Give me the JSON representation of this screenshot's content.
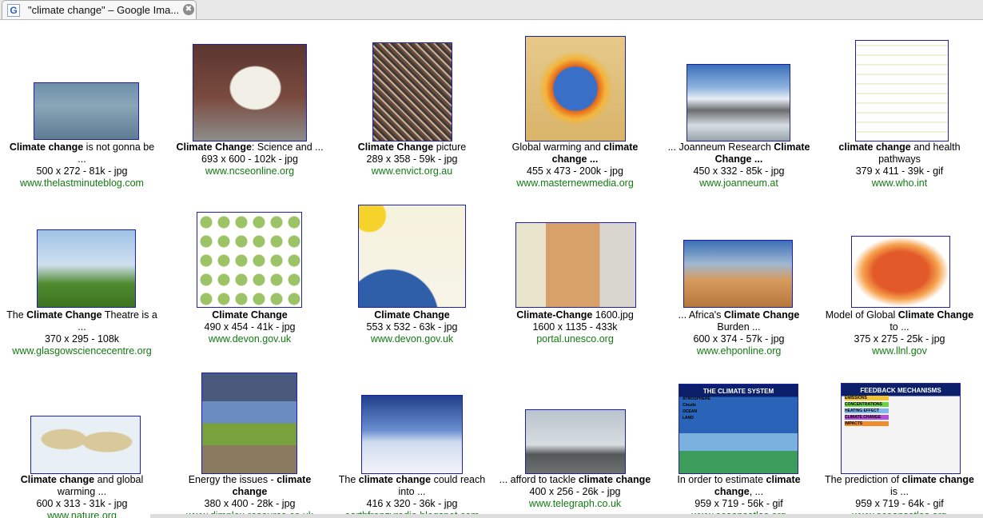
{
  "tab": {
    "title": "\"climate change\" – Google Ima...",
    "favicon": "G",
    "close": "✖"
  },
  "results": [
    {
      "title_parts": [
        {
          "b": true,
          "t": "Climate change"
        },
        {
          "b": false,
          "t": " is not gonna be"
        }
      ],
      "title2": "...",
      "meta": "500 x 272 - 81k - jpg",
      "site": "www.thelastminuteblog.com",
      "image": "flooded-cars"
    },
    {
      "title_parts": [
        {
          "b": true,
          "t": "Climate Change"
        },
        {
          "b": false,
          "t": ": Science and ..."
        }
      ],
      "title2": "",
      "meta": "693 x 600 - 102k - jpg",
      "site": "www.ncseonline.org",
      "image": "polar-bear"
    },
    {
      "title_parts": [
        {
          "b": true,
          "t": "Climate Change"
        },
        {
          "b": false,
          "t": " picture"
        }
      ],
      "title2": "",
      "meta": "289 x 358 - 59k - jpg",
      "site": "www.envict.org.au",
      "image": "crowd-protest"
    },
    {
      "title_parts": [
        {
          "b": false,
          "t": "Global warming and "
        },
        {
          "b": true,
          "t": "climate"
        }
      ],
      "title2": "change ...",
      "title2_bold": true,
      "meta": "455 x 473 - 200k - jpg",
      "site": "www.masternewmedia.org",
      "image": "burning-globe"
    },
    {
      "title_parts": [
        {
          "b": false,
          "t": "... Joanneum Research "
        },
        {
          "b": true,
          "t": "Climate"
        }
      ],
      "title2": "Change ...",
      "title2_bold": true,
      "meta": "450 x 332 - 85k - jpg",
      "site": "www.joanneum.at",
      "image": "glacier-mountains"
    },
    {
      "title_parts": [
        {
          "b": true,
          "t": "climate change"
        },
        {
          "b": false,
          "t": " and health"
        }
      ],
      "title2": "pathways",
      "meta": "379 x 411 - 39k - gif",
      "site": "www.who.int",
      "image": "health-pathways-diagram"
    },
    {
      "title_parts": [
        {
          "b": false,
          "t": "The "
        },
        {
          "b": true,
          "t": "Climate Change"
        },
        {
          "b": false,
          "t": " Theatre is a"
        }
      ],
      "title2": "...",
      "meta": "370 x 295 - 108k",
      "site": "www.glasgowsciencecentre.org",
      "image": "sheep-field"
    },
    {
      "title_parts": [
        {
          "b": true,
          "t": "Climate Change"
        }
      ],
      "title2": "",
      "meta": "490 x 454 - 41k - jpg",
      "site": "www.devon.gov.uk",
      "image": "timeline-chart"
    },
    {
      "title_parts": [
        {
          "b": true,
          "t": "Climate Change"
        }
      ],
      "title2": "",
      "meta": "553 x 532 - 63k - jpg",
      "site": "www.devon.gov.uk",
      "image": "greenhouse-effect"
    },
    {
      "title_parts": [
        {
          "b": true,
          "t": "Climate-Change"
        },
        {
          "b": false,
          "t": " 1600.jpg"
        }
      ],
      "title2": "",
      "meta": "1600 x 1135 - 433k",
      "site": "portal.unesco.org",
      "image": "desert-poster"
    },
    {
      "title_parts": [
        {
          "b": false,
          "t": "... Africa's "
        },
        {
          "b": true,
          "t": "Climate Change"
        }
      ],
      "title2": "Burden ...",
      "meta": "600 x 374 - 57k - jpg",
      "site": "www.ehponline.org",
      "image": "dust-storm-woman"
    },
    {
      "title_parts": [
        {
          "b": false,
          "t": "Model of Global "
        },
        {
          "b": true,
          "t": "Climate Change"
        }
      ],
      "title2": "to ...",
      "meta": "375 x 275 - 25k - jpg",
      "site": "www.llnl.gov",
      "image": "temperature-map"
    },
    {
      "title_parts": [
        {
          "b": true,
          "t": "Climate change"
        },
        {
          "b": false,
          "t": " and global"
        }
      ],
      "title2": "warming ...",
      "meta": "600 x 313 - 31k - jpg",
      "site": "www.nature.org",
      "image": "world-map"
    },
    {
      "title_parts": [
        {
          "b": false,
          "t": "Energy the issues - "
        },
        {
          "b": true,
          "t": "climate"
        }
      ],
      "title2": "change",
      "title2_bold": true,
      "meta": "380 x 400 - 28k - jpg",
      "site": "www.dimplex-resource.co.uk",
      "image": "photo-collage"
    },
    {
      "title_parts": [
        {
          "b": false,
          "t": "The "
        },
        {
          "b": true,
          "t": "climate change"
        },
        {
          "b": false,
          "t": " could reach"
        }
      ],
      "title2": "into ...",
      "meta": "416 x 320 - 36k - jpg",
      "site": "earthfrenzyradio.blogspot.com",
      "image": "ice-landscape"
    },
    {
      "title_parts": [
        {
          "b": false,
          "t": "... afford to tackle "
        },
        {
          "b": true,
          "t": "climate change"
        }
      ],
      "title2": "",
      "meta": "400 x 256 - 26k - jpg",
      "site": "www.telegraph.co.uk",
      "image": "industrial-skyline"
    },
    {
      "title_parts": [
        {
          "b": false,
          "t": "In order to estimate "
        },
        {
          "b": true,
          "t": "climate"
        }
      ],
      "title2_parts": [
        {
          "b": true,
          "t": "change"
        },
        {
          "b": false,
          "t": ", ..."
        }
      ],
      "meta": "959 x 719 - 56k - gif",
      "site": "www.oceansatlas.org",
      "image": "climate-system-slide",
      "slide_title": "THE CLIMATE SYSTEM",
      "slide_labels": [
        "ATMOSPHERE",
        "Clouds",
        "OCEAN",
        "LAND"
      ]
    },
    {
      "title_parts": [
        {
          "b": false,
          "t": "The prediction of "
        },
        {
          "b": true,
          "t": "climate change"
        }
      ],
      "title2": "is ...",
      "meta": "959 x 719 - 64k - gif",
      "site": "www.oceansatlas.org",
      "image": "feedback-slide",
      "slide_title": "FEEDBACK MECHANISMS",
      "slide_labels": [
        "EMISSIONS",
        "CONCENTRATIONS",
        "HEATING EFFECT",
        "CLIMATE CHANGE",
        "IMPACTS"
      ]
    }
  ]
}
